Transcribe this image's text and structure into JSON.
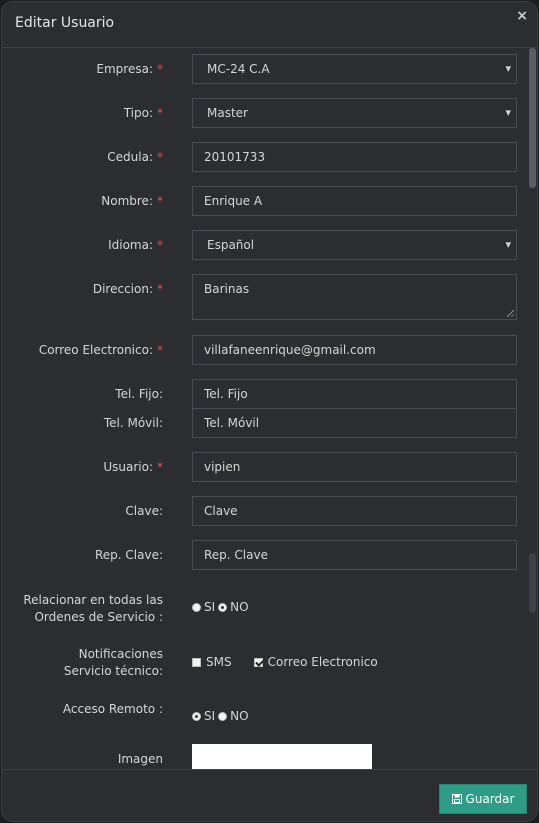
{
  "modal": {
    "title": "Editar Usuario",
    "close_icon": "×",
    "save_label": "Guardar",
    "save_icon": "floppy-disk-icon"
  },
  "fields": {
    "empresa": {
      "label": "Empresa:",
      "value": "MC-24 C.A"
    },
    "tipo": {
      "label": "Tipo:",
      "value": "Master"
    },
    "cedula": {
      "label": "Cedula:",
      "value": "20101733"
    },
    "nombre": {
      "label": "Nombre:",
      "value": "Enrique A"
    },
    "idioma": {
      "label": "Idioma:",
      "value": "Español"
    },
    "direccion": {
      "label": "Direccion:",
      "value": "Barinas"
    },
    "correo": {
      "label": "Correo Electronico:",
      "value": "villafaneenrique@gmail.com"
    },
    "tel_fijo": {
      "label": "Tel. Fijo:",
      "placeholder": "Tel. Fijo"
    },
    "tel_movil": {
      "label": "Tel. Móvil:",
      "placeholder": "Tel. Móvil"
    },
    "usuario": {
      "label": "Usuario:",
      "value": "vipien"
    },
    "clave": {
      "label": "Clave:",
      "placeholder": "Clave"
    },
    "rep_clave": {
      "label": "Rep. Clave:",
      "placeholder": "Rep. Clave"
    },
    "relacionar": {
      "label_line1": "Relacionar en todas las",
      "label_line2": "Ordenes de Servicio :",
      "opt_si": "SI",
      "opt_no": "NO",
      "selected": "NO"
    },
    "notificaciones": {
      "label_line1": "Notificaciones",
      "label_line2": "Servicio técnico:",
      "opt_sms": "SMS",
      "opt_correo": "Correo Electronico",
      "sms_checked": false,
      "correo_checked": true
    },
    "acceso_remoto": {
      "label": "Acceso Remoto :",
      "opt_si": "SI",
      "opt_no": "NO",
      "selected": "SI"
    },
    "imagen": {
      "label": "Imagen"
    }
  },
  "required_mark": "*",
  "colors": {
    "accent": "#2e9c86",
    "required": "#d9534f",
    "background": "#2b2d30"
  }
}
